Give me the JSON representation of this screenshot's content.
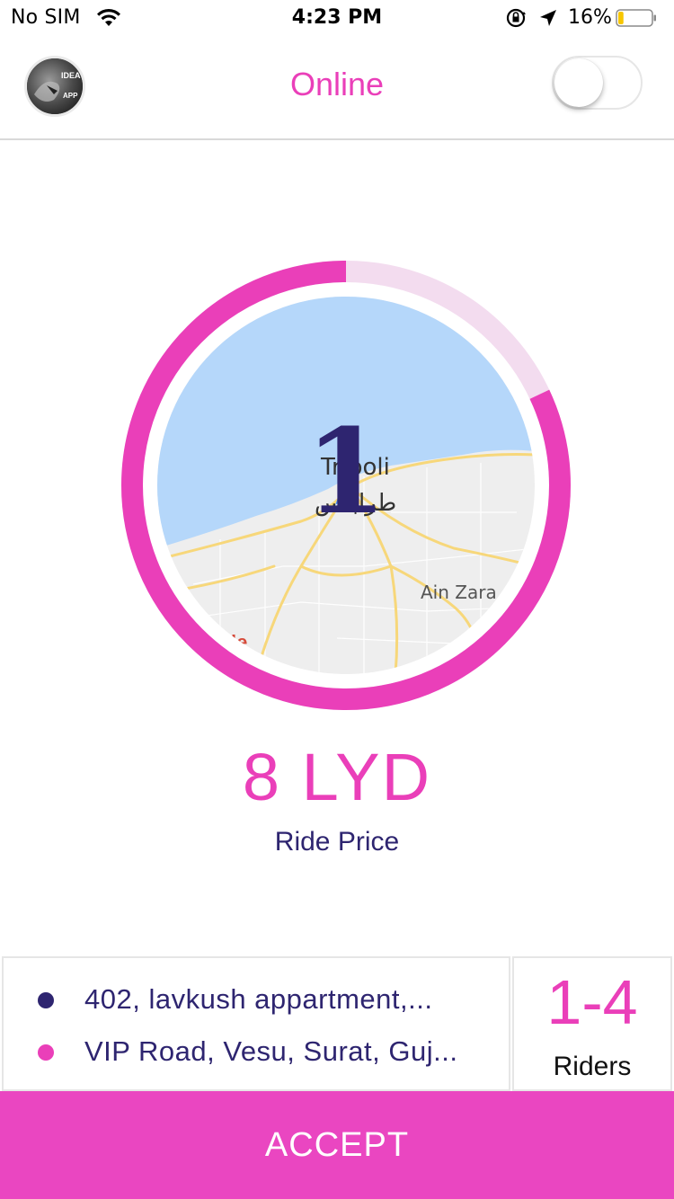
{
  "status_bar": {
    "carrier": "No SIM",
    "time": "4:23 PM",
    "battery_percent": "16%",
    "battery_level": 0.16,
    "icons": [
      "wifi-icon",
      "orientation-lock-icon",
      "location-arrow-icon",
      "battery-icon"
    ]
  },
  "header": {
    "title": "Online",
    "avatar_text_lines": [
      "IDEA",
      "APP"
    ],
    "online_toggle_on": false
  },
  "request": {
    "countdown": "1",
    "timer_progress": 0.82,
    "map": {
      "labels": [
        "Tripoli",
        "طرابلس",
        "Ain Zara"
      ],
      "logo_fragment": "le"
    }
  },
  "price": {
    "value": "8 LYD",
    "label": "Ride Price"
  },
  "trip": {
    "pickup": "402, lavkush appartment,...",
    "drop": "VIP Road, Vesu, Surat, Guj..."
  },
  "riders": {
    "range": "1-4",
    "label": "Riders"
  },
  "accept_label": "ACCEPT",
  "colors": {
    "accent_pink": "#ea3fb9",
    "dark_indigo": "#2e2570",
    "ring_track": "#f3dcef",
    "sea_blue": "#b5d7fa"
  }
}
